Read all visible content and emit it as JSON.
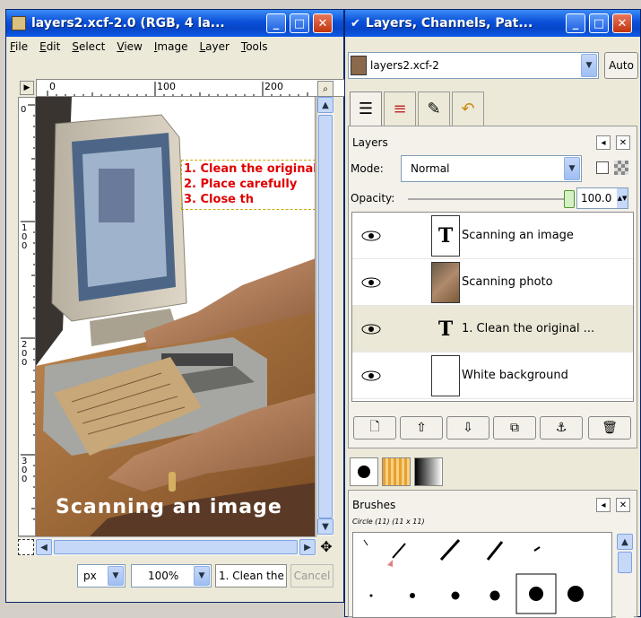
{
  "image_window": {
    "title": "layers2.xcf-2.0 (RGB, 4 la...",
    "menu": [
      "File",
      "Edit",
      "Select",
      "View",
      "Image",
      "Layer",
      "Tools"
    ],
    "hruler_labels": [
      "0",
      "100",
      "200"
    ],
    "vruler_labels": [
      "0",
      "100",
      "200",
      "300"
    ],
    "canvas_caption": "Scanning an image",
    "canvas_text_lines": [
      "1. Clean the original",
      "2. Place carefully",
      "3. Close th"
    ],
    "unit_value": "px",
    "zoom_value": "100%",
    "status_text": "1. Clean the",
    "cancel_label": "Cancel"
  },
  "dock_window": {
    "title": "Layers, Channels, Pat...",
    "image_combo_value": "layers2.xcf-2",
    "auto_label": "Auto",
    "tab_icons": [
      "layers-tab-icon",
      "channels-tab-icon",
      "paths-tab-icon",
      "undo-tab-icon"
    ],
    "layers": {
      "title": "Layers",
      "mode_label": "Mode:",
      "mode_value": "Normal",
      "opacity_label": "Opacity:",
      "opacity_value": "100.0",
      "opacity_fraction": 1.0,
      "items": [
        {
          "name": "Scanning an image",
          "thumb": "text",
          "selected": false
        },
        {
          "name": "Scanning photo",
          "thumb": "photo",
          "selected": false
        },
        {
          "name": "1. Clean the original ...",
          "thumb": "text",
          "selected": true
        },
        {
          "name": "White background",
          "thumb": "white",
          "selected": false
        }
      ],
      "buttons": [
        "new-layer",
        "raise-layer",
        "lower-layer",
        "duplicate-layer",
        "anchor-layer",
        "delete-layer"
      ]
    },
    "brushes": {
      "title": "Brushes",
      "subtitle": "Circle (11) (11 x 11)"
    }
  },
  "colors": {
    "titlebar_blue": "#0a4fd8",
    "canvas_text_red": "#e00000",
    "selection_row": "#ebe8d8"
  }
}
